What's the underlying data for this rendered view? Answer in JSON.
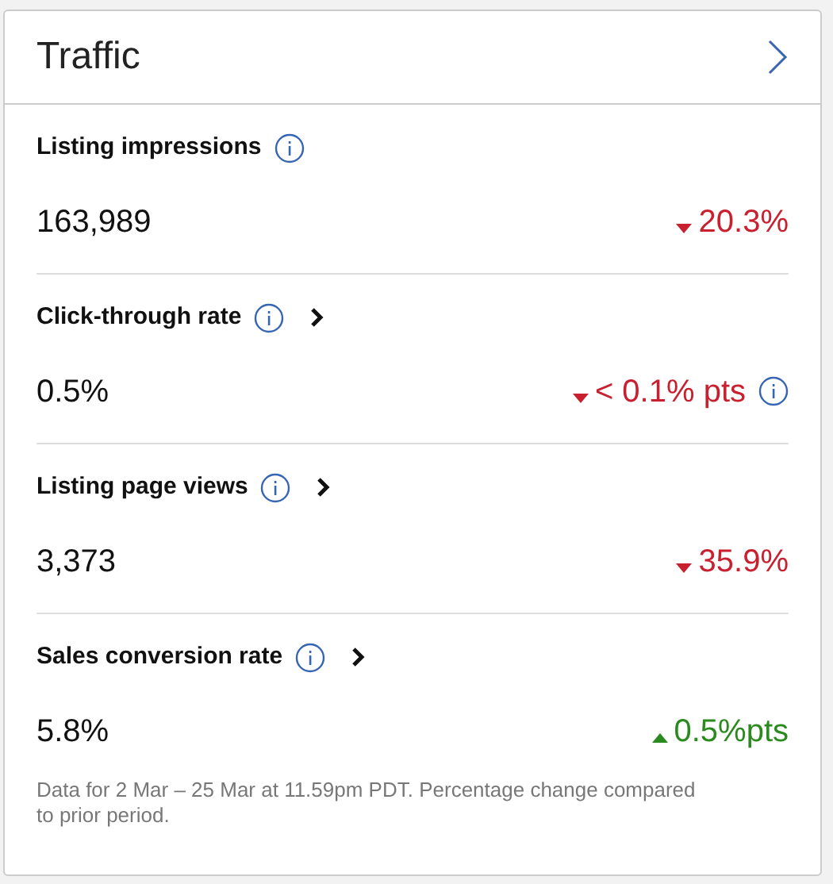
{
  "card": {
    "title": "Traffic"
  },
  "metrics": [
    {
      "label": "Listing impressions",
      "info": true,
      "link": false,
      "value": "163,989",
      "kind": "down",
      "change": "20.3%",
      "change_info": false
    },
    {
      "label": "Click-through rate",
      "info": true,
      "link": true,
      "value": "0.5%",
      "kind": "down",
      "change": "< 0.1% pts",
      "change_info": true
    },
    {
      "label": "Listing page views",
      "info": true,
      "link": true,
      "value": "3,373",
      "kind": "down",
      "change": "35.9%",
      "change_info": false
    },
    {
      "label": "Sales conversion rate",
      "info": true,
      "link": true,
      "value": "5.8%",
      "kind": "up",
      "change": "0.5%pts",
      "change_info": false
    }
  ],
  "footnote": "Data for 2 Mar – 25 Mar at 11.59pm PDT. Percentage change compared to prior period."
}
